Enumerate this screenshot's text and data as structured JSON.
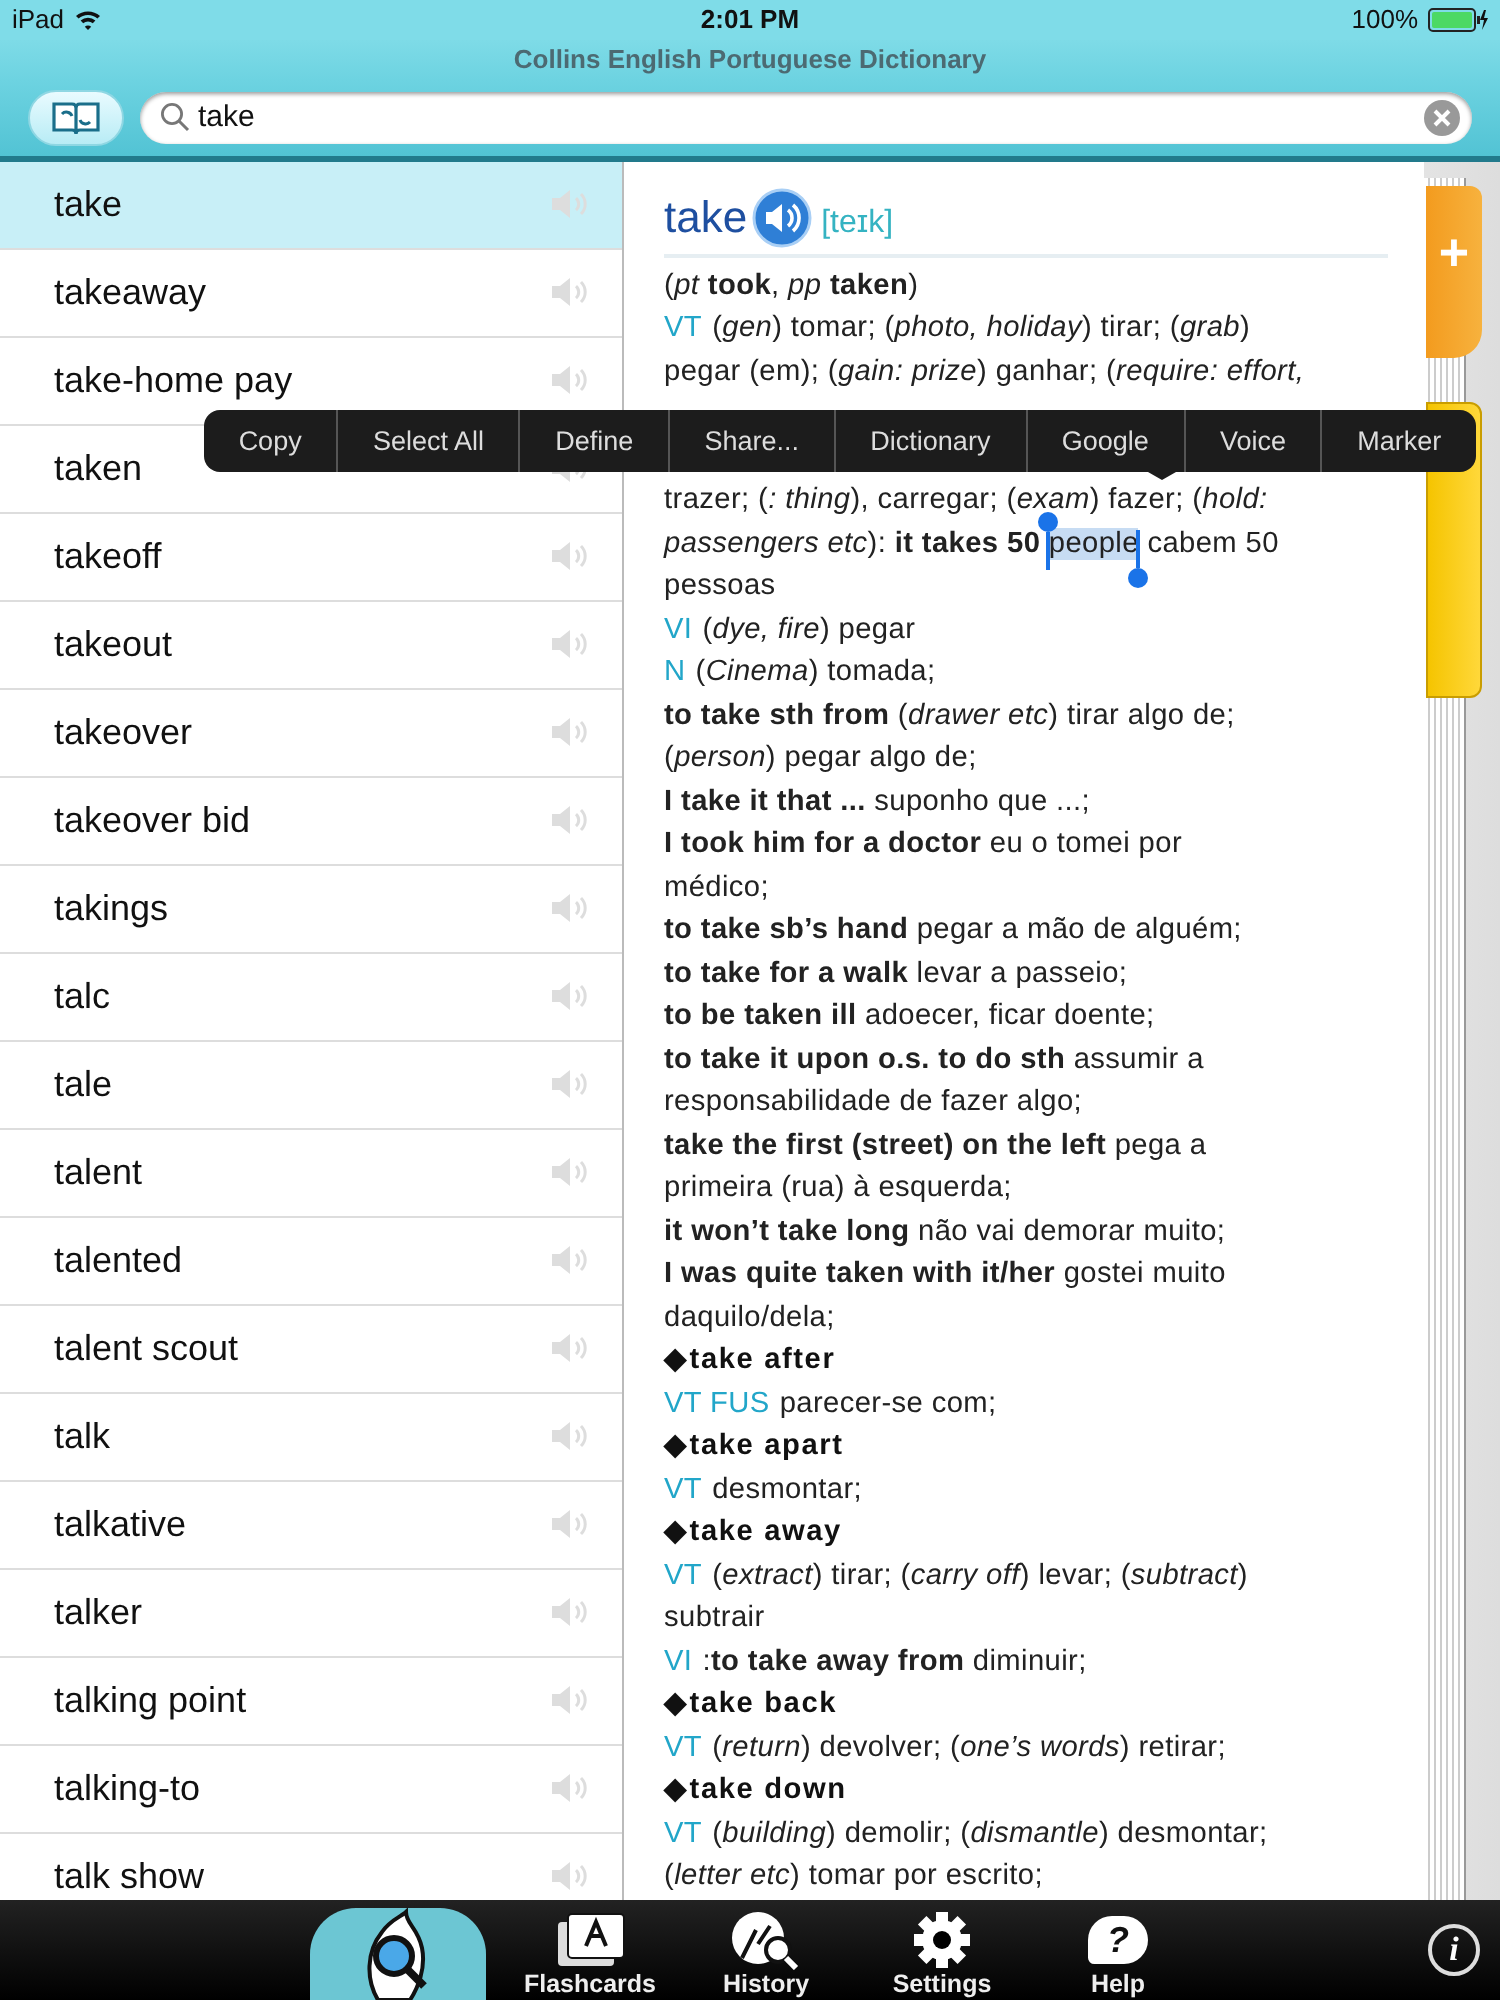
{
  "status_bar": {
    "device": "iPad",
    "time": "2:01 PM",
    "battery": "100%"
  },
  "title": "Collins English Portuguese Dictionary",
  "search": {
    "value": "take"
  },
  "words": [
    {
      "label": "take",
      "selected": true
    },
    {
      "label": "takeaway",
      "selected": false
    },
    {
      "label": "take-home pay",
      "selected": false
    },
    {
      "label": "taken",
      "selected": false
    },
    {
      "label": "takeoff",
      "selected": false
    },
    {
      "label": "takeout",
      "selected": false
    },
    {
      "label": "takeover",
      "selected": false
    },
    {
      "label": "takeover bid",
      "selected": false
    },
    {
      "label": "takings",
      "selected": false
    },
    {
      "label": "talc",
      "selected": false
    },
    {
      "label": "tale",
      "selected": false
    },
    {
      "label": "talent",
      "selected": false
    },
    {
      "label": "talented",
      "selected": false
    },
    {
      "label": "talent scout",
      "selected": false
    },
    {
      "label": "talk",
      "selected": false
    },
    {
      "label": "talkative",
      "selected": false
    },
    {
      "label": "talker",
      "selected": false
    },
    {
      "label": "talking point",
      "selected": false
    },
    {
      "label": "talking-to",
      "selected": false
    },
    {
      "label": "talk show",
      "selected": false
    }
  ],
  "entry": {
    "headword": "take",
    "pronunciation": "[teɪk]",
    "lines": [
      {
        "kind": "line",
        "text": "(*pt* **took**, *pp* **taken**)"
      },
      {
        "kind": "line",
        "pos": "VT",
        "text": "(*gen*) tomar; (*photo, holiday*) tirar; (*grab*)"
      },
      {
        "kind": "line",
        "text": "pegar (em); (*gain: prize*) ganhar; (*require: effort,*"
      },
      {
        "kind": "menu",
        "items": [
          "Copy",
          "Select All",
          "Define",
          "Share...",
          "Dictionary",
          "Google",
          "Voice",
          "Marker"
        ]
      },
      {
        "kind": "line",
        "text": "trazer; (*: thing*), carregar; (*exam*) fazer; (*hold:*"
      },
      {
        "kind": "line",
        "text": "*passengers etc*): **it takes 50** ",
        "mark": "people",
        "rest": " cabem 50"
      },
      {
        "kind": "line",
        "text": "pessoas"
      },
      {
        "kind": "line",
        "pos": "VI",
        "text": "(*dye, fire*) pegar"
      },
      {
        "kind": "line",
        "pos": "N",
        "text": "(*Cinema*) tomada;"
      },
      {
        "kind": "line",
        "text": "**to take sth from** (*drawer etc*) tirar algo de;"
      },
      {
        "kind": "line",
        "text": "(*person*) pegar algo de;"
      },
      {
        "kind": "line",
        "text": "**I take it that ...** suponho que ...;"
      },
      {
        "kind": "line",
        "text": "**I took him for a doctor** eu o tomei por"
      },
      {
        "kind": "line",
        "text": "médico;"
      },
      {
        "kind": "line",
        "text": "**to take sb’s hand** pegar a mão de alguém;"
      },
      {
        "kind": "line",
        "text": "**to take for a walk** levar a passeio;"
      },
      {
        "kind": "line",
        "text": "**to be taken ill** adoecer, ficar doente;"
      },
      {
        "kind": "line",
        "text": "**to take it upon o.s. to do sth** assumir a"
      },
      {
        "kind": "line",
        "text": "responsabilidade de fazer algo;"
      },
      {
        "kind": "line",
        "text": "**take the first (street) on the left** pega a"
      },
      {
        "kind": "line",
        "text": "primeira (rua) à esquerda;"
      },
      {
        "kind": "line",
        "text": "**it won’t take long** não vai demorar muito;"
      },
      {
        "kind": "line",
        "text": "**I was quite taken with it/her** gostei muito"
      },
      {
        "kind": "line",
        "text": "daquilo/dela;"
      },
      {
        "kind": "phrase",
        "text": "◆take after"
      },
      {
        "kind": "line",
        "pos": "VT FUS",
        "text": "parecer-se com;"
      },
      {
        "kind": "phrase",
        "text": "◆take apart"
      },
      {
        "kind": "line",
        "pos": "VT",
        "text": "desmontar;"
      },
      {
        "kind": "phrase",
        "text": "◆take away"
      },
      {
        "kind": "line",
        "pos": "VT",
        "text": "(*extract*) tirar; (*carry off*) levar; (*subtract*)"
      },
      {
        "kind": "line",
        "text": "subtrair"
      },
      {
        "kind": "line",
        "pos": "VI",
        "text": ":**to take away from** diminuir;"
      },
      {
        "kind": "phrase",
        "text": "◆take back"
      },
      {
        "kind": "line",
        "pos": "VT",
        "text": "(*return*) devolver; (*one’s words*) retirar;"
      },
      {
        "kind": "phrase",
        "text": "◆take down"
      },
      {
        "kind": "line",
        "pos": "VT",
        "text": "(*building*) demolir; (*dismantle*) desmontar;"
      },
      {
        "kind": "line",
        "text": "(*letter etc*) tomar por escrito;"
      }
    ]
  },
  "add_tab": {
    "label": "+"
  },
  "toolbar": [
    {
      "kind": "search"
    },
    {
      "kind": "flashcards",
      "label": "Flashcards"
    },
    {
      "kind": "history",
      "label": "History"
    },
    {
      "kind": "settings",
      "label": "Settings"
    },
    {
      "kind": "help",
      "label": "Help",
      "glyph": "?"
    }
  ],
  "info": {
    "glyph": "i"
  }
}
